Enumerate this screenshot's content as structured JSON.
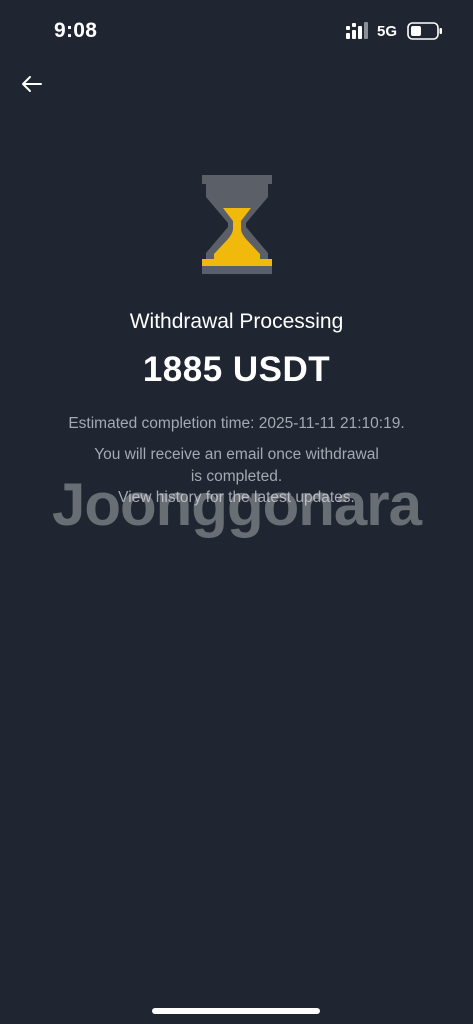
{
  "status_bar": {
    "time": "9:08",
    "network": "5G",
    "signal_icon": "cellular-signal-icon",
    "battery_icon": "battery-icon"
  },
  "nav": {
    "back_icon": "arrow-left-icon"
  },
  "withdrawal": {
    "status_icon": "hourglass-icon",
    "title": "Withdrawal Processing",
    "amount": "1885 USDT",
    "estimated_completion": "Estimated completion time: 2025-11-11 21:10:19.",
    "info_lines": [
      "You will receive an email once withdrawal",
      "is completed.",
      "View history for the latest updates."
    ]
  },
  "watermark": "Joonggonara",
  "colors": {
    "background": "#1f2631",
    "accent": "#f0b90b",
    "hourglass_frame": "#5a5f68",
    "secondary_text": "#a4a9b2"
  }
}
